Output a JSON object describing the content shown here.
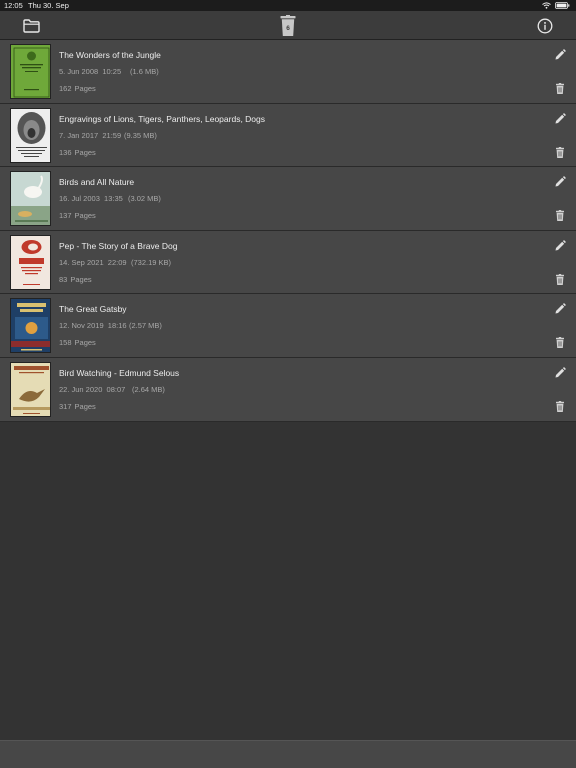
{
  "status_bar": {
    "time": "12:05",
    "date": "Thu 30. Sep",
    "icons": [
      "wifi-icon",
      "battery-icon"
    ]
  },
  "toolbar": {
    "left_icon": "folder-icon",
    "center_icon": "trash-icon",
    "trash_count": "6",
    "right_icon": "info-icon"
  },
  "books": [
    {
      "title": "The Wonders of the Jungle",
      "date": "5. Jun 2008  10:25",
      "size": "(1.6 MB)",
      "pages": "162",
      "pages_label": "Pages",
      "cover_color": "#6fa83a"
    },
    {
      "title": "Engravings of Lions, Tigers, Panthers, Leopards, Dogs",
      "date": "7. Jan 2017  21:59",
      "size": "(9.35 MB)",
      "pages": "136",
      "pages_label": "Pages",
      "cover_color": "#e8e8e8"
    },
    {
      "title": "Birds and All Nature",
      "date": "16. Jul 2003  13:35",
      "size": "(3.02 MB)",
      "pages": "137",
      "pages_label": "Pages",
      "cover_color": "#b9cfc9"
    },
    {
      "title": "Pep - The Story of a Brave Dog",
      "date": "14. Sep 2021  22:09",
      "size": "(732.19 KB)",
      "pages": "83",
      "pages_label": "Pages",
      "cover_color": "#f1e7df"
    },
    {
      "title": "The Great Gatsby",
      "date": "12. Nov 2019  18:16",
      "size": "(2.57 MB)",
      "pages": "158",
      "pages_label": "Pages",
      "cover_color": "#1f3f66"
    },
    {
      "title": "Bird Watching - Edmund Selous",
      "date": "22. Jun 2020  08:07",
      "size": "(2.64 MB)",
      "pages": "317",
      "pages_label": "Pages",
      "cover_color": "#e5dcb5"
    }
  ]
}
